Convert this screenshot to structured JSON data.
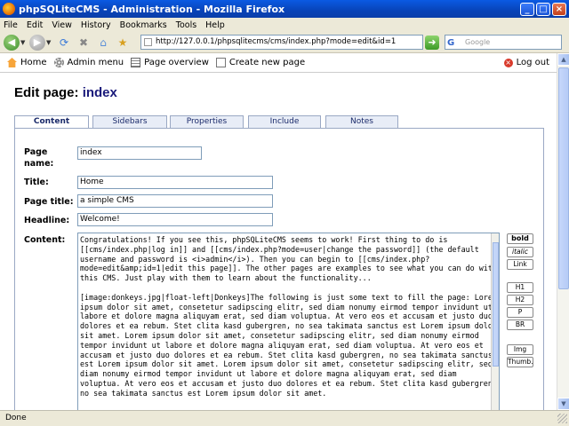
{
  "window": {
    "title": "phpSQLiteCMS - Administration - Mozilla Firefox"
  },
  "menu": {
    "items": [
      "File",
      "Edit",
      "View",
      "History",
      "Bookmarks",
      "Tools",
      "Help"
    ]
  },
  "navbar": {
    "url": "http://127.0.0.1/phpsqlitecms/cms/index.php?mode=edit&id=1",
    "search_placeholder": "Google"
  },
  "topnav": {
    "home": "Home",
    "admin_menu": "Admin menu",
    "page_overview": "Page overview",
    "create_new_page": "Create new page",
    "logout": "Log out"
  },
  "heading": {
    "prefix": "Edit page:",
    "page_name": "index"
  },
  "tabs": [
    "Content",
    "Sidebars",
    "Properties",
    "Include",
    "Notes"
  ],
  "form": {
    "page_name_label": "Page name:",
    "page_name_value": "index",
    "title_label": "Title:",
    "title_value": "Home",
    "page_title_label": "Page title:",
    "page_title_value": "a simple CMS",
    "headline_label": "Headline:",
    "headline_value": "Welcome!",
    "content_label": "Content:",
    "content_value": "Congratulations! If you see this, phpSQLiteCMS seems to work! First thing to do is [[cms/index.php|log in]] and [[cms/index.php?mode=user|change the password]] (the default username and password is <i>admin</i>). Then you can begin to [[cms/index.php?mode=edit&amp;id=1|edit this page]]. The other pages are examples to see what you can do with this CMS. Just play with them to learn about the functionality...\n\n[image:donkeys.jpg|float-left|Donkeys]The following is just some text to fill the page: Lorem ipsum dolor sit amet, consetetur sadipscing elitr, sed diam nonumy eirmod tempor invidunt ut labore et dolore magna aliquyam erat, sed diam voluptua. At vero eos et accusam et justo duo dolores et ea rebum. Stet clita kasd gubergren, no sea takimata sanctus est Lorem ipsum dolor sit amet. Lorem ipsum dolor sit amet, consetetur sadipscing elitr, sed diam nonumy eirmod tempor invidunt ut labore et dolore magna aliquyam erat, sed diam voluptua. At vero eos et accusam et justo duo dolores et ea rebum. Stet clita kasd gubergren, no sea takimata sanctus est Lorem ipsum dolor sit amet. Lorem ipsum dolor sit amet, consetetur sadipscing elitr, sed diam nonumy eirmod tempor invidunt ut labore et dolore magna aliquyam erat, sed diam voluptua. At vero eos et accusam et justo duo dolores et ea rebum. Stet clita kasd gubergren, no sea takimata sanctus est Lorem ipsum dolor sit amet."
  },
  "editor_buttons": [
    "bold",
    "italic",
    "Link",
    "H1",
    "H2",
    "P",
    "BR",
    "Img",
    "Thumb."
  ],
  "statusbar": {
    "text": "Done"
  }
}
